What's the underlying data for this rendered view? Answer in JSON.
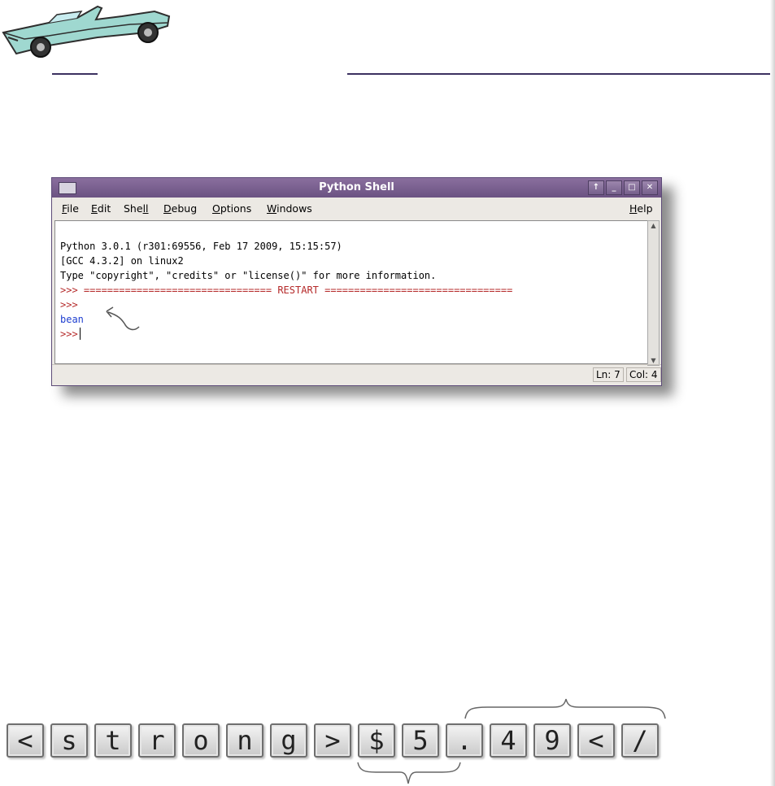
{
  "window": {
    "title": "Python Shell",
    "buttons": [
      "↑",
      "_",
      "□",
      "✕"
    ]
  },
  "menu": [
    {
      "first": "F",
      "rest": "ile"
    },
    {
      "first": "E",
      "rest": "dit"
    },
    {
      "first": "She",
      "rest": "ll",
      "underline_second": true
    },
    {
      "first": "D",
      "rest": "ebug"
    },
    {
      "first": "O",
      "rest": "ptions"
    },
    {
      "first": "W",
      "rest": "indows"
    },
    {
      "first": "H",
      "rest": "elp"
    }
  ],
  "shell": {
    "line1": "Python 3.0.1 (r301:69556, Feb 17 2009, 15:15:57)",
    "line2": "[GCC 4.3.2] on linux2",
    "line3": "Type \"copyright\", \"credits\" or \"license()\" for more information.",
    "prompt": ">>>",
    "restart": " ================================ RESTART ================================",
    "output": "bean"
  },
  "status": {
    "ln": "Ln: 7",
    "col": "Col: 4"
  },
  "keys": [
    "<",
    "s",
    "t",
    "r",
    "o",
    "n",
    "g",
    ">",
    "$",
    "5",
    ".",
    "4",
    "9",
    "<",
    "/"
  ],
  "colors": {
    "titlebar": "#7a5f92",
    "prompt": "#b52a2a",
    "output": "#1f3fd0",
    "rule": "#3c3160"
  }
}
